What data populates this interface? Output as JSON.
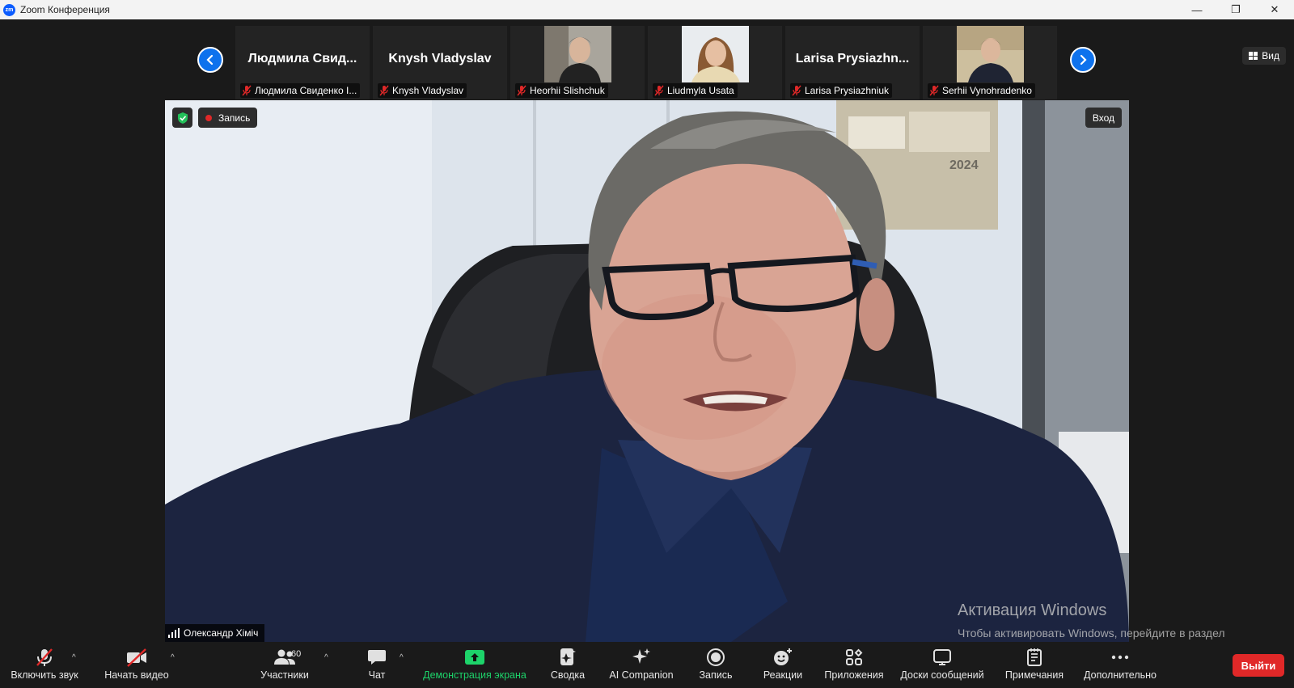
{
  "window": {
    "title": "Zoom Конференция",
    "logo_text": "zm",
    "controls": {
      "minimize": "—",
      "restore": "❐",
      "close": "✕"
    }
  },
  "gallery": {
    "prev_icon": "chevron-left-icon",
    "next_icon": "chevron-right-icon",
    "tiles": [
      {
        "display": "Людмила  Свид...",
        "label": "Людмила Свиденко I...",
        "has_video": false
      },
      {
        "display": "Knysh Vladyslav",
        "label": "Knysh Vladyslav",
        "has_video": false
      },
      {
        "display": "",
        "label": "Heorhii Slishchuk",
        "has_video": true
      },
      {
        "display": "",
        "label": "Liudmyla Usata",
        "has_video": true
      },
      {
        "display": "Larisa  Prysiazhn...",
        "label": "Larisa Prysiazhniuk",
        "has_video": false
      },
      {
        "display": "",
        "label": "Serhii Vynohradenko",
        "has_video": true
      }
    ],
    "view_button": "Вид"
  },
  "main_video": {
    "recording_label": "Запись",
    "enter_button": "Вход",
    "speaker_name": "Олександр Хіміч",
    "calendar_year": "2024"
  },
  "watermark": {
    "title": "Активация Windows",
    "subtitle": "Чтобы активировать Windows, перейдите в раздел \"Параметры\"."
  },
  "toolbar": {
    "audio": "Включить звук",
    "video": "Начать видео",
    "participants": "Участники",
    "participants_count": "60",
    "chat": "Чат",
    "share": "Демонстрация экрана",
    "summary": "Сводка",
    "ai": "AI Companion",
    "record": "Запись",
    "reactions": "Реакции",
    "apps": "Приложения",
    "whiteboards": "Доски сообщений",
    "notes": "Примечания",
    "more": "Дополнительно",
    "leave": "Выйти"
  },
  "colors": {
    "accent": "#0e72ed",
    "share_green": "#1dd36a",
    "leave_red": "#e02828",
    "mute_red": "#e02828"
  }
}
